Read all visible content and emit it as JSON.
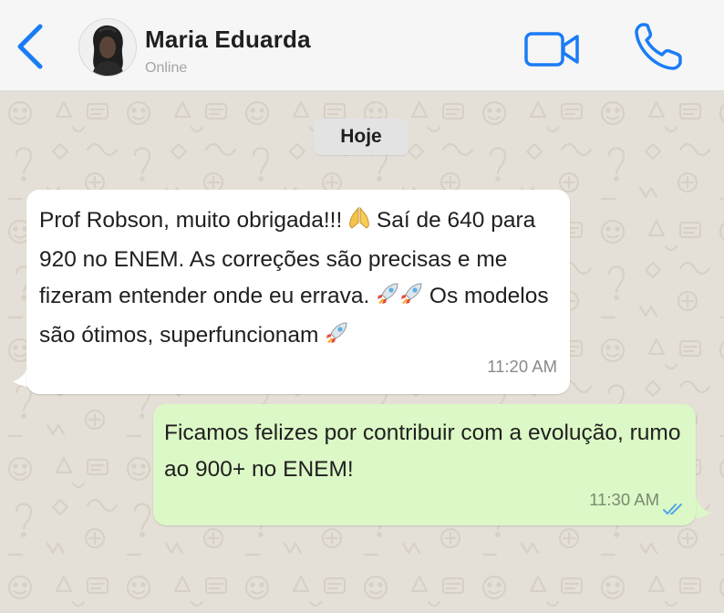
{
  "header": {
    "contact_name": "Maria Eduarda",
    "status": "Online",
    "back_icon": "chevron-left",
    "video_icon": "video-camera",
    "call_icon": "phone",
    "accent_color": "#1a7cf5"
  },
  "chat": {
    "date_label": "Hoje",
    "wallpaper_color": "#e5e0d7",
    "messages": [
      {
        "direction": "incoming",
        "segments": {
          "part1": "Prof Robson, muito obrigada!!! ",
          "part2": " Saí de 640 para 920 no ENEM. As correções são precisas e me fizeram entender onde eu errava. ",
          "part3": " Os modelos são ótimos, superfuncionam "
        },
        "emojis": [
          "folded-hands",
          "rocket",
          "rocket",
          "rocket"
        ],
        "time": "11:20 AM",
        "bubble_color": "#ffffff"
      },
      {
        "direction": "outgoing",
        "text": "Ficamos felizes por contribuir com a evolução, rumo ao 900+ no ENEM!",
        "time": "11:30 AM",
        "read_status": "read",
        "bubble_color": "#dcf8c6",
        "tick_color": "#4fa6e8"
      }
    ]
  }
}
